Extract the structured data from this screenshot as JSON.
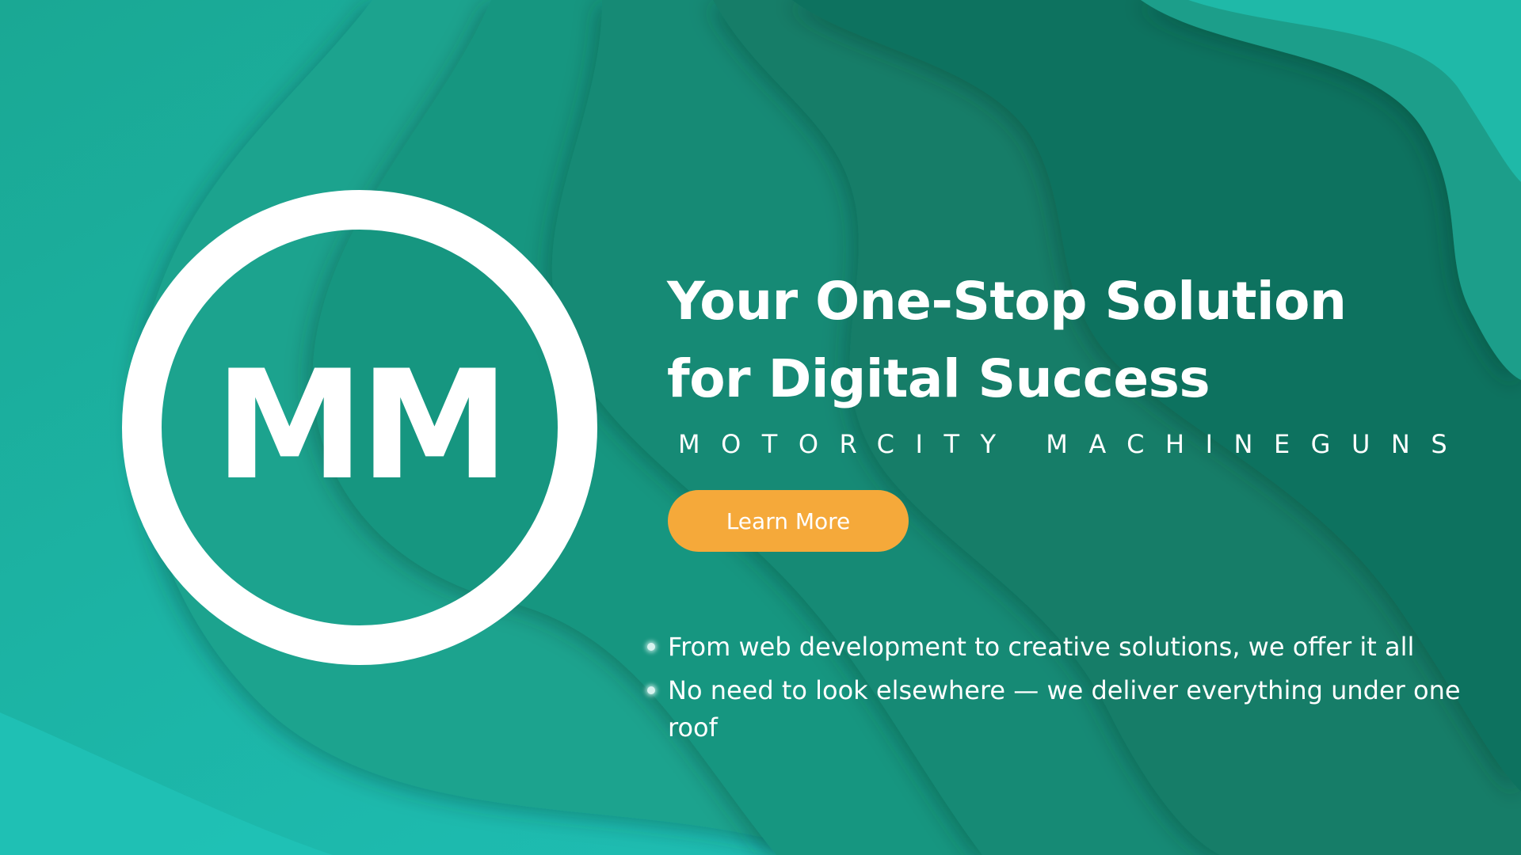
{
  "logo": {
    "monogram": "MM",
    "color": "#ffffff"
  },
  "hero": {
    "headline_line1": "Your One-Stop Solution",
    "headline_line2": "for Digital Success",
    "brand_name": "MOTORCITY MACHINEGUNS",
    "cta_label": "Learn More",
    "bullets": [
      "From web development to creative solutions, we offer it all",
      "No need to look elsewhere — we deliver everything under one roof"
    ]
  },
  "colors": {
    "background_light": "#1fbfae",
    "background_dark": "#0f6b58",
    "accent": "#f5a93a",
    "text": "#ffffff"
  }
}
